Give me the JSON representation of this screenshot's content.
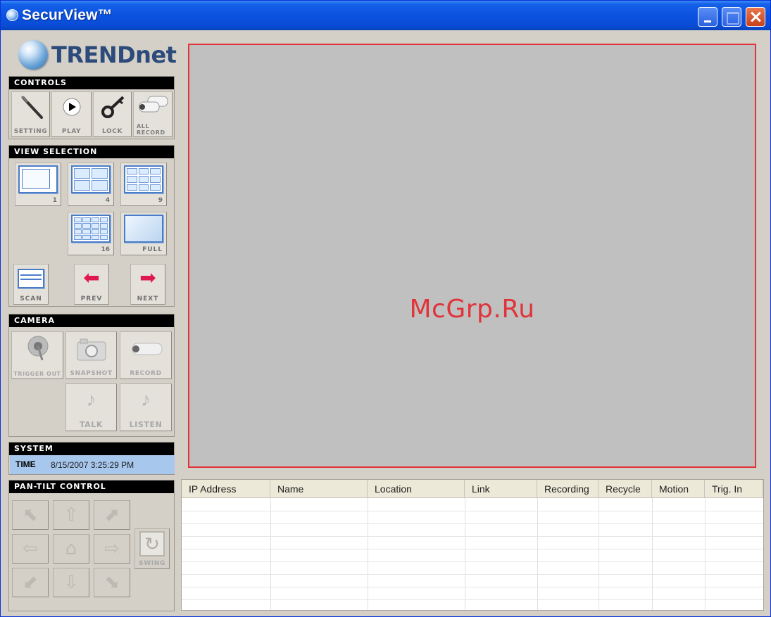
{
  "window": {
    "title": "SecurView™"
  },
  "logo": {
    "text": "TRENDnet"
  },
  "controls": {
    "header": "CONTROLS",
    "buttons": [
      {
        "label": "SETTING",
        "icon": "wrench-icon"
      },
      {
        "label": "PLAY",
        "icon": "play-icon"
      },
      {
        "label": "LOCK",
        "icon": "key-icon"
      },
      {
        "label": "ALL RECORD",
        "icon": "cameras-icon"
      }
    ]
  },
  "view_selection": {
    "header": "VIEW SELECTION",
    "layouts": [
      "1",
      "4",
      "9",
      "16",
      "FULL"
    ],
    "scan": "SCAN",
    "prev": "PREV",
    "next": "NEXT"
  },
  "camera": {
    "header": "CAMERA",
    "trigger_out": "TRIGGER OUT",
    "snapshot": "SNAPSHOT",
    "record": "RECORD",
    "talk": "TALK",
    "listen": "LISTEN"
  },
  "system": {
    "header": "SYSTEM",
    "time_label": "TIME",
    "time_value": "8/15/2007 3:25:29 PM"
  },
  "pan_tilt": {
    "header": "PAN-TILT CONTROL",
    "swing": "SWING"
  },
  "video": {
    "watermark": "McGrp.Ru"
  },
  "camera_table": {
    "columns": [
      "IP Address",
      "Name",
      "Location",
      "Link",
      "Recording",
      "Recycle",
      "Motion",
      "Trig. In"
    ],
    "rows": []
  },
  "colors": {
    "accent": "#0a4bd4",
    "video_border": "#e0343a",
    "time_bg": "#a7c7ec"
  }
}
